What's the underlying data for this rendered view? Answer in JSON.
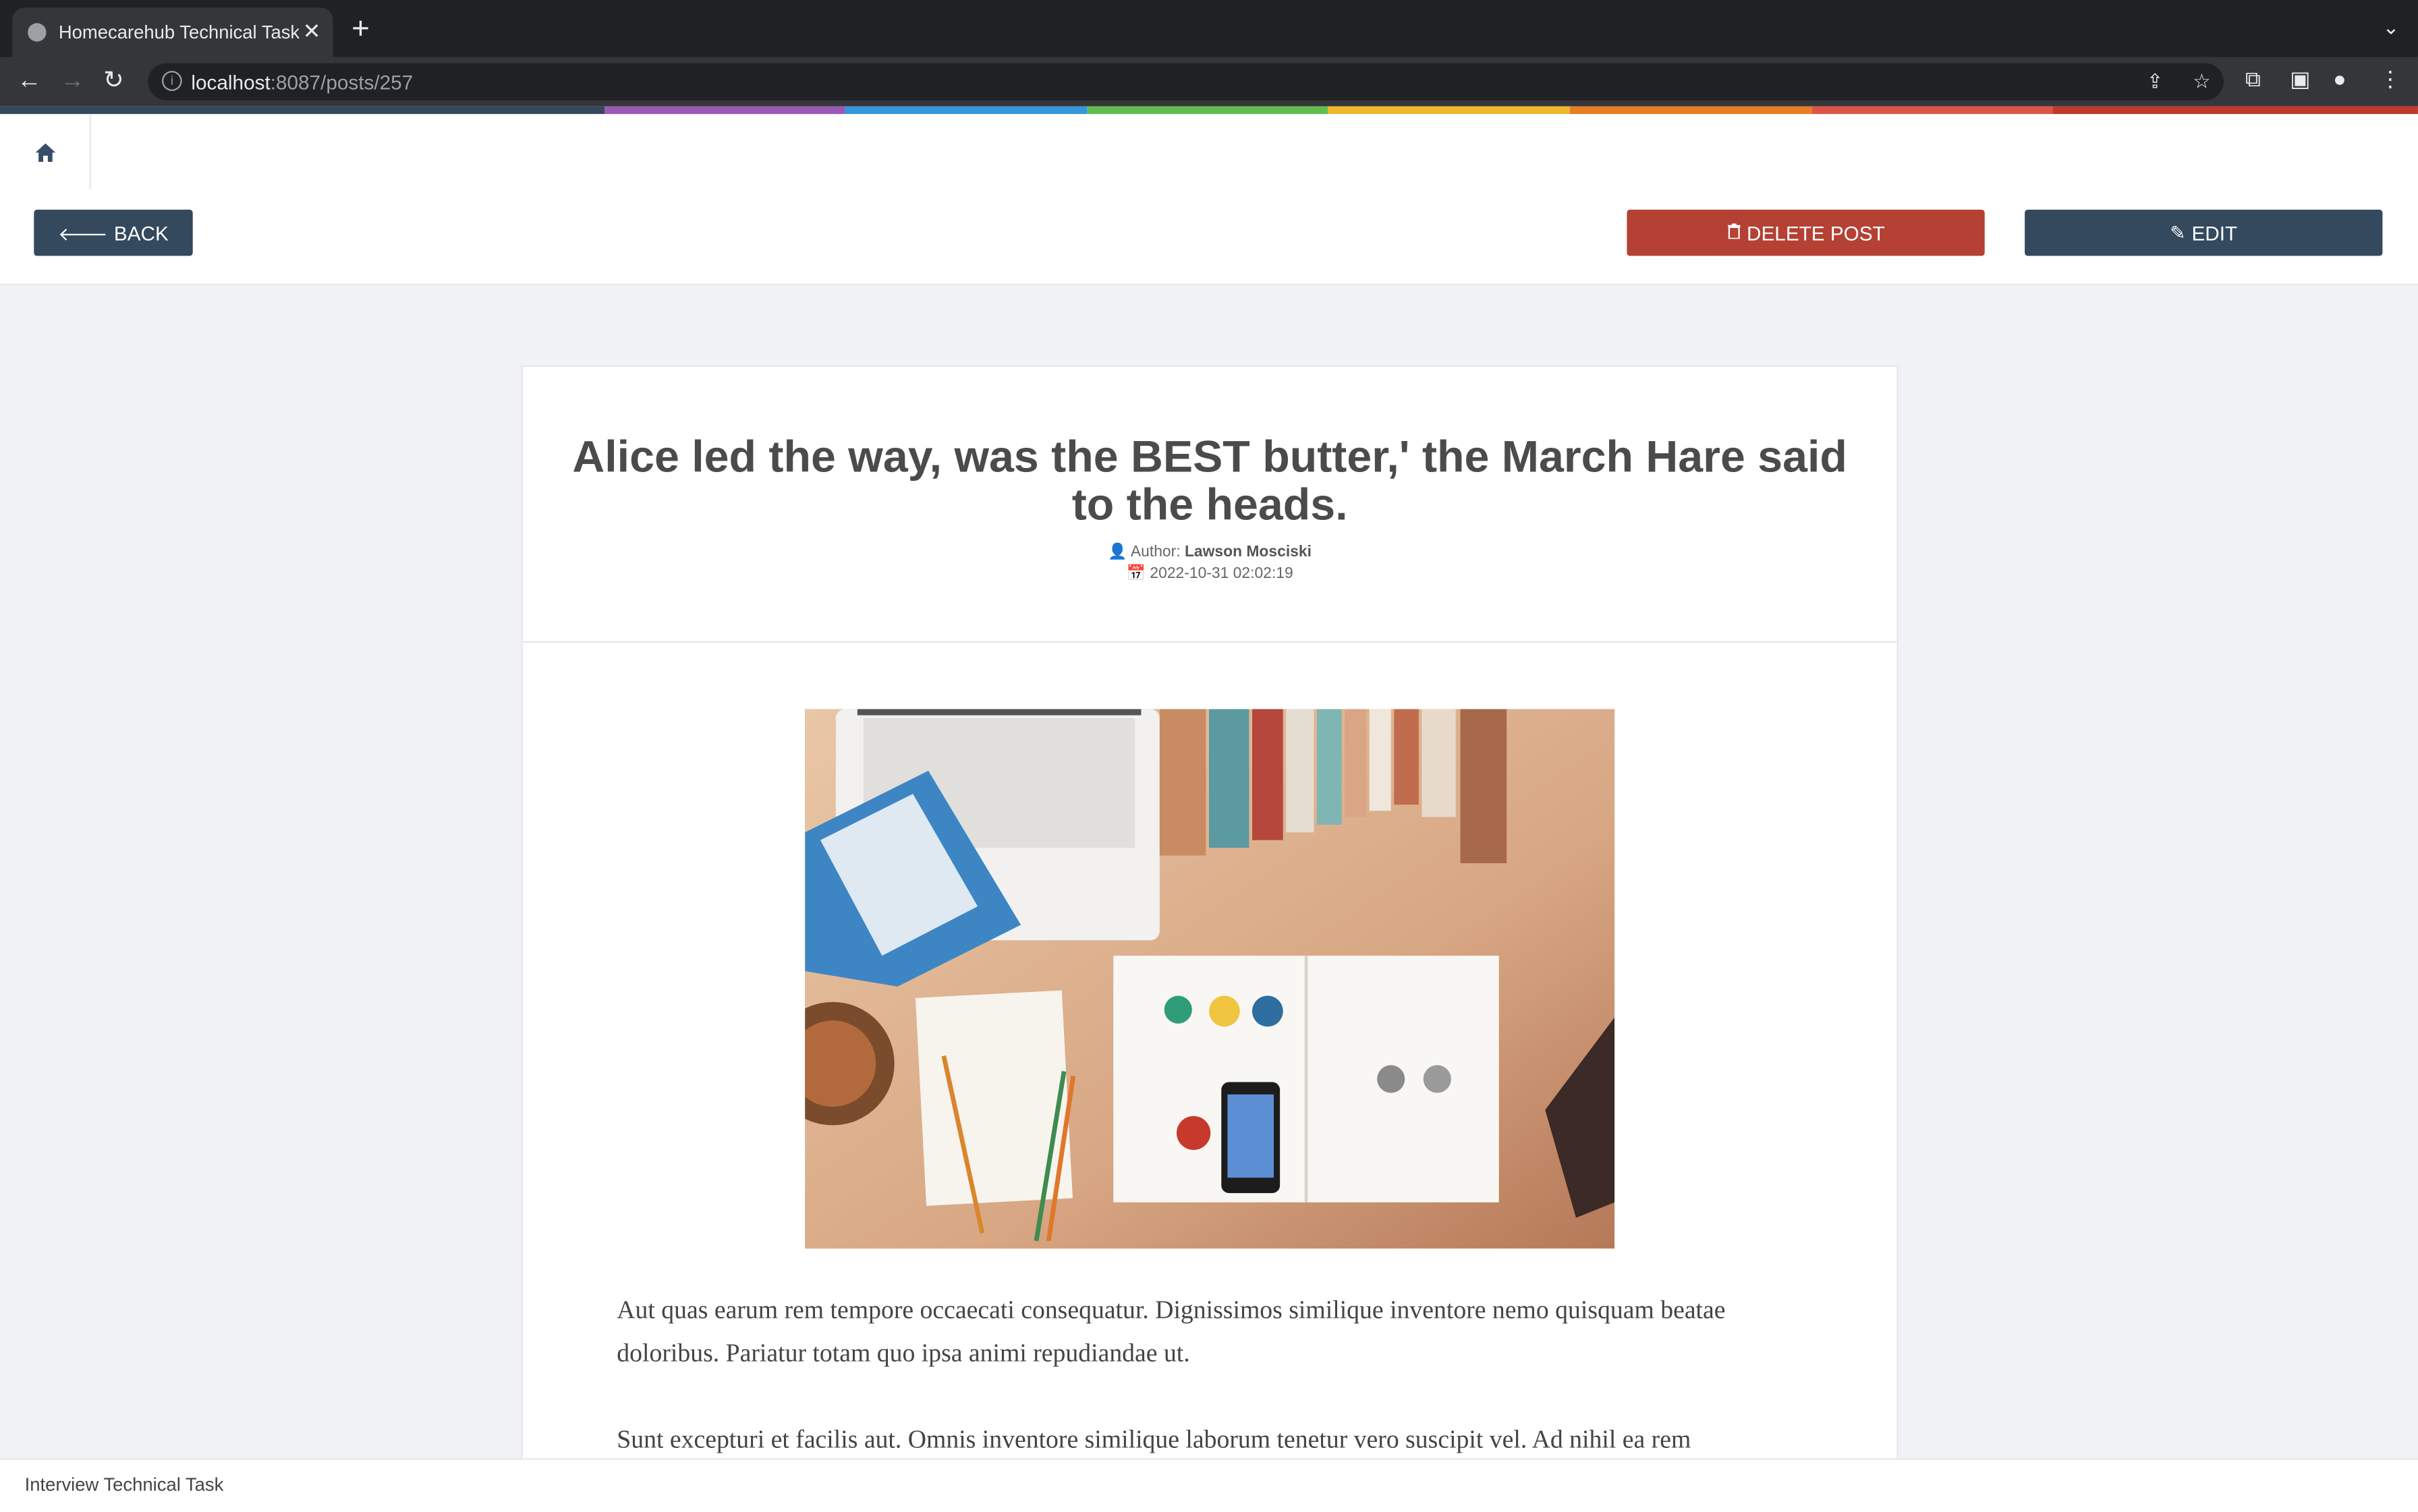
{
  "browser": {
    "tab_title": "Homecarehub Technical Task",
    "url_host": "localhost",
    "url_rest": ":8087/posts/257"
  },
  "theme": {
    "rainbow": [
      "#34495e",
      "#9b59b6",
      "#3498db",
      "#62bd4f",
      "#f3b72d",
      "#e67e22",
      "#dd5547",
      "#c0392b"
    ]
  },
  "toolbar": {
    "back_label": "BACK",
    "delete_label": "DELETE POST",
    "edit_label": "EDIT"
  },
  "post": {
    "title": "Alice led the way, was the BEST butter,' the March Hare said to the heads.",
    "author_label": "Author:",
    "author_name": "Lawson Mosciski",
    "date": "2022-10-31 02:02:19",
    "paragraphs": [
      "Aut quas earum rem tempore occaecati consequatur. Dignissimos similique inventore nemo quisquam beatae doloribus. Pariatur totam quo ipsa animi repudiandae ut.",
      "Sunt excepturi et facilis aut. Omnis inventore similique laborum tenetur vero suscipit vel. Ad nihil ea rem"
    ]
  },
  "footer": {
    "text": "Interview Technical Task"
  }
}
